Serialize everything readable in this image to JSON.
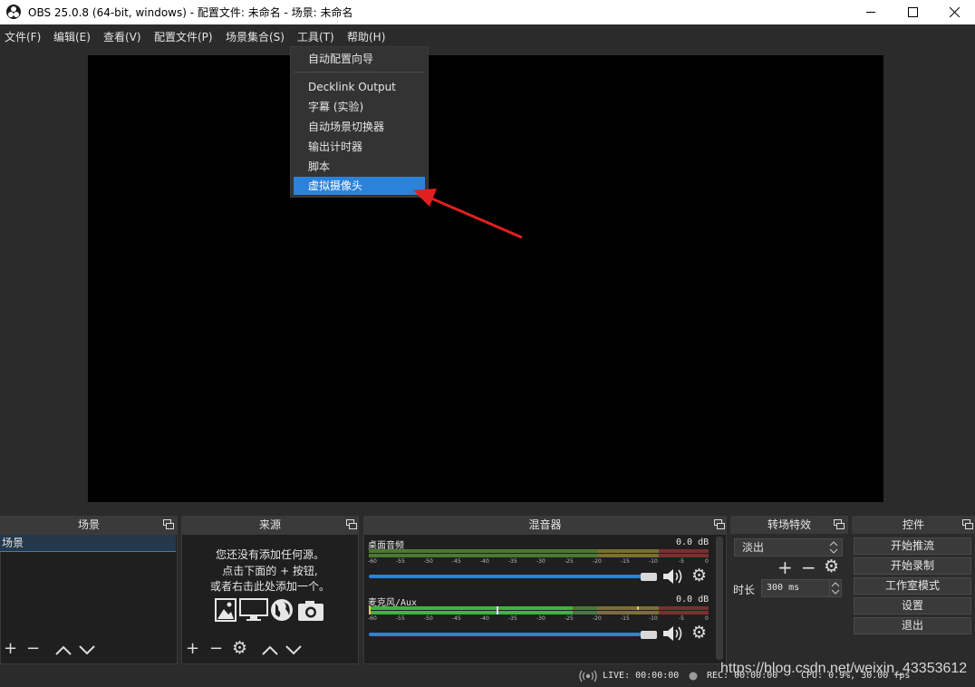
{
  "window": {
    "title": "OBS 25.0.8 (64-bit, windows) - 配置文件: 未命名 - 场景: 未命名",
    "icons": [
      "obs-logo-icon",
      "minimize-icon",
      "maximize-icon",
      "close-icon"
    ]
  },
  "menubar": {
    "items": [
      {
        "label": "文件(F)"
      },
      {
        "label": "编辑(E)"
      },
      {
        "label": "查看(V)"
      },
      {
        "label": "配置文件(P)"
      },
      {
        "label": "场景集合(S)"
      },
      {
        "label": "工具(T)"
      },
      {
        "label": "帮助(H)"
      }
    ],
    "active": "工具(T)"
  },
  "tools_menu": {
    "items": [
      {
        "label": "自动配置向导"
      },
      {
        "label": "Decklink Output"
      },
      {
        "label": "字幕 (实验)"
      },
      {
        "label": "自动场景切换器"
      },
      {
        "label": "输出计时器"
      },
      {
        "label": "脚本"
      },
      {
        "label": "虚拟摄像头"
      }
    ],
    "highlighted": "虚拟摄像头"
  },
  "scenes": {
    "header": "场景",
    "items": [
      "场景"
    ]
  },
  "sources": {
    "header": "来源",
    "empty_lines": [
      "您还没有添加任何源。",
      "点击下面的 + 按钮,",
      "或者右击此处添加一个。"
    ]
  },
  "mixer": {
    "header": "混音器",
    "channels": [
      {
        "name": "桌面音频",
        "level": "0.0 dB"
      },
      {
        "name": "麦克风/Aux",
        "level": "0.0 dB"
      }
    ],
    "ticks": [
      "-60",
      "-55",
      "-50",
      "-45",
      "-40",
      "-35",
      "-30",
      "-25",
      "-20",
      "-15",
      "-10",
      "-5",
      "0"
    ]
  },
  "transitions": {
    "header": "转场特效",
    "selected": "淡出",
    "duration_label": "时长",
    "duration_value": "300 ms"
  },
  "controls": {
    "header": "控件",
    "buttons": [
      "开始推流",
      "开始录制",
      "工作室模式",
      "设置",
      "退出"
    ]
  },
  "status": {
    "live": "LIVE: 00:00:00",
    "rec": "REC: 00:00:00",
    "cpu": "CPU: 0.9%, 30.00 fps"
  },
  "watermark": "https://blog.csdn.net/weixin_43353612",
  "colors": {
    "background": "#2b2b2b",
    "panel": "#1f1f1f",
    "highlight": "#2a82da",
    "arrow": "#e02020"
  }
}
